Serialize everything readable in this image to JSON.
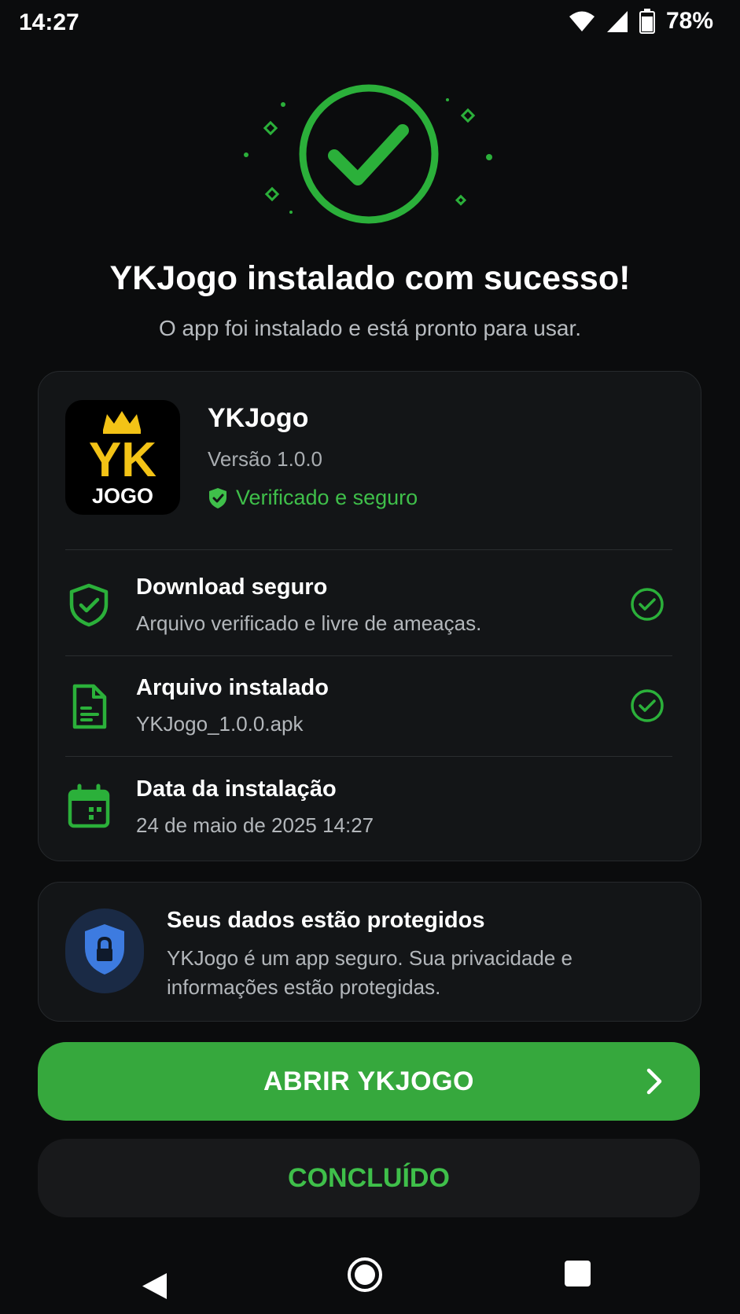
{
  "status_bar": {
    "time": "14:27",
    "battery_percent": "78%",
    "icons": [
      "wifi-icon",
      "signal-icon",
      "battery-icon"
    ]
  },
  "hero": {
    "icon": "check-circle-icon",
    "title": "YKJogo instalado com sucesso!",
    "subtitle": "O app foi instalado e está pronto para usar."
  },
  "app": {
    "logo_text_top": "YK",
    "logo_text_bottom": "JOGO",
    "name": "YKJogo",
    "version": "Versão 1.0.0",
    "verified_label": "Verificado e seguro"
  },
  "details": [
    {
      "icon": "shield-check-icon",
      "title": "Download seguro",
      "subtitle": "Arquivo verificado e livre de ameaças.",
      "checked": true
    },
    {
      "icon": "file-icon",
      "title": "Arquivo instalado",
      "subtitle": "YKJogo_1.0.0.apk",
      "checked": true
    },
    {
      "icon": "calendar-icon",
      "title": "Data da instalação",
      "subtitle": "24 de maio de 2025 14:27",
      "checked": false
    }
  ],
  "protection": {
    "icon": "lock-shield-icon",
    "title": "Seus dados estão protegidos",
    "text": "YKJogo é um app seguro. Sua privacidade e informações estão protegidas."
  },
  "buttons": {
    "primary_label": "ABRIR YKJOGO",
    "secondary_label": "CONCLUÍDO"
  },
  "colors": {
    "accent_green": "#36a83d",
    "text_green": "#3fbf4a",
    "background": "#0b0c0d",
    "card": "#131517",
    "protect_blue": "#3d7be0"
  }
}
